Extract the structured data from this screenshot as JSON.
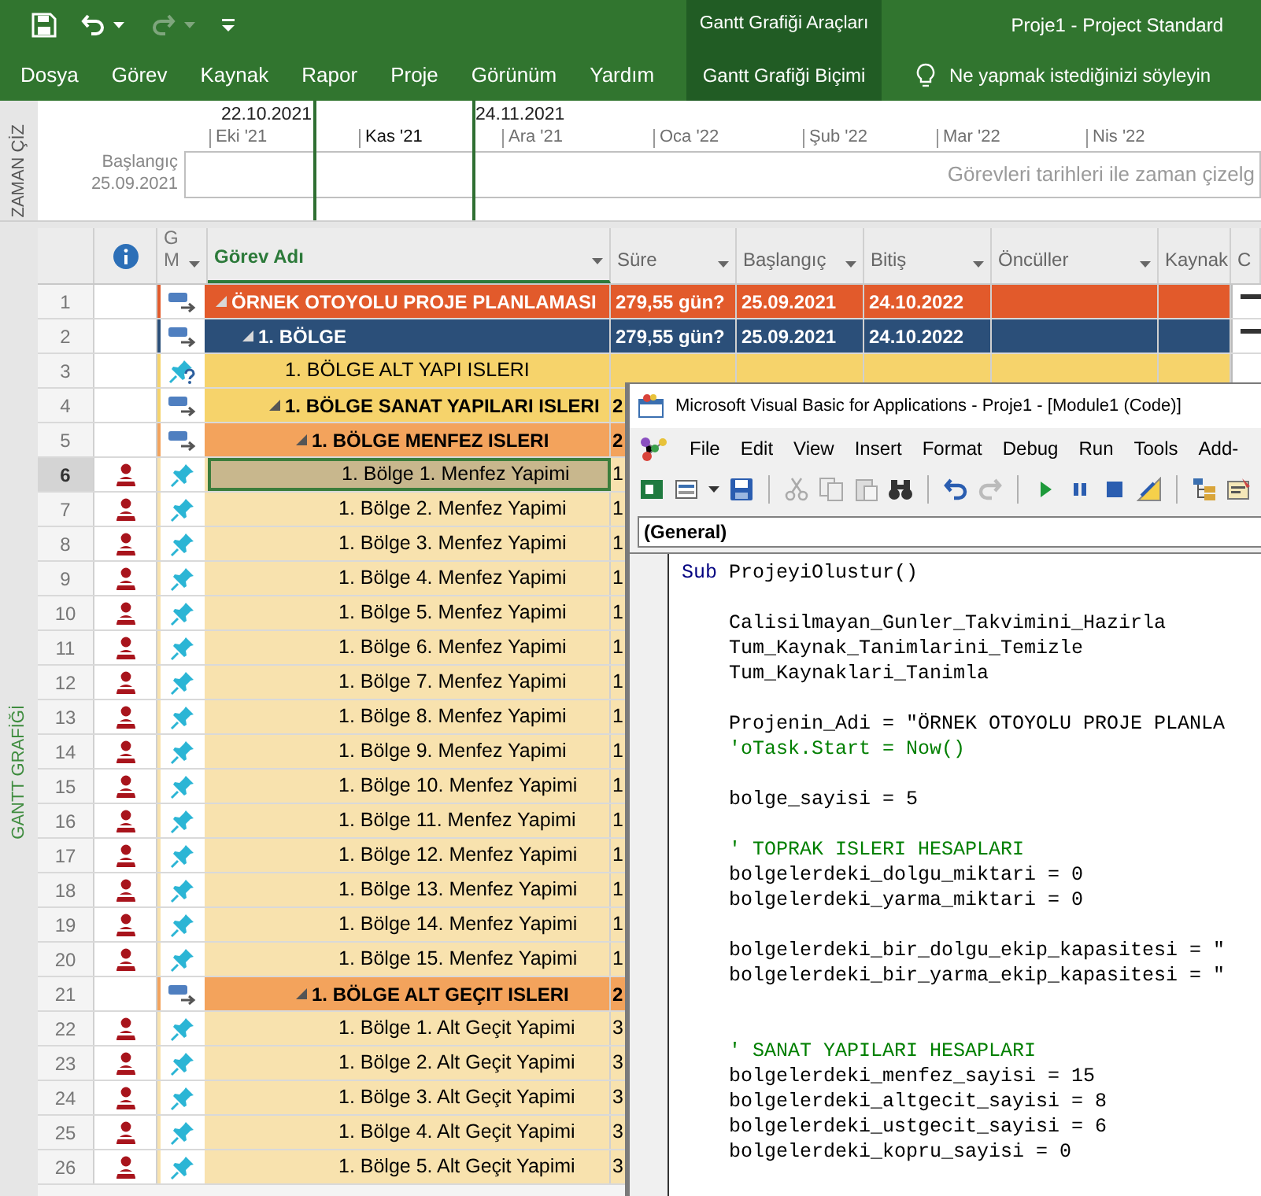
{
  "title_bar": {
    "context_group": "Gantt Grafiği Araçları",
    "title": "Proje1 - Project Standard"
  },
  "ribbon": {
    "tabs": [
      {
        "label": "Dosya",
        "selected": false
      },
      {
        "label": "Görev",
        "selected": false
      },
      {
        "label": "Kaynak",
        "selected": false
      },
      {
        "label": "Rapor",
        "selected": false
      },
      {
        "label": "Proje",
        "selected": false
      },
      {
        "label": "Görünüm",
        "selected": false
      },
      {
        "label": "Yardım",
        "selected": false
      }
    ],
    "context_tab": "Gantt Grafiği Biçimi",
    "tell_me": "Ne yapmak istediğinizi söyleyin"
  },
  "timeline": {
    "side_label": "ZAMAN ÇİZ",
    "range_start": "22.10.2021",
    "range_end": "24.11.2021",
    "months": [
      {
        "label": "Eki '21",
        "in_range": false
      },
      {
        "label": "Kas '21",
        "in_range": true
      },
      {
        "label": "Ara '21",
        "in_range": false
      },
      {
        "label": "Oca '22",
        "in_range": false
      },
      {
        "label": "Şub '22",
        "in_range": false
      },
      {
        "label": "Mar '22",
        "in_range": false
      },
      {
        "label": "Nis '22",
        "in_range": false
      }
    ],
    "start_label": "Başlangıç",
    "start_date": "25.09.2021",
    "hint": "Görevleri tarihleri ile zaman çizelg"
  },
  "gantt": {
    "side_label": "GANTT GRAFİĞİ",
    "columns": [
      {
        "kind": "info"
      },
      {
        "kind": "mode",
        "label": "G M",
        "selected": false,
        "filter": true
      },
      {
        "kind": "name",
        "label": "Görev Adı",
        "selected": true,
        "filter": true
      },
      {
        "kind": "duration",
        "label": "Süre",
        "selected": false,
        "filter": true
      },
      {
        "kind": "start",
        "label": "Başlangıç",
        "selected": false,
        "filter": true
      },
      {
        "kind": "finish",
        "label": "Bitiş",
        "selected": false,
        "filter": true
      },
      {
        "kind": "predecessors",
        "label": "Öncüller",
        "selected": false,
        "filter": true
      },
      {
        "kind": "resources",
        "label": "Kaynak",
        "selected": false,
        "filter": false
      },
      {
        "kind": "chart",
        "label": "C",
        "selected": false,
        "filter": false
      }
    ],
    "rows": [
      {
        "id": "1",
        "assigned": false,
        "kind": "auto",
        "name": "ÖRNEK OTOYOLU PROJE PLANLAMASI",
        "duration": "279,55 gün?",
        "start": "25.09.2021",
        "finish": "24.10.2022",
        "color": "#e25a2b",
        "selected": false,
        "expanded": true,
        "children": [
          {
            "id": "2",
            "assigned": false,
            "kind": "auto",
            "name": "1. BÖLGE",
            "duration": "279,55 gün?",
            "start": "25.09.2021",
            "finish": "24.10.2022",
            "color": "#2b4f79",
            "selected": false,
            "expanded": true,
            "children": [
              {
                "id": "3",
                "assigned": false,
                "kind": "manual_unscheduled",
                "name": "1. BÖLGE ALT YAPI ISLERI",
                "color": "#f6d36b",
                "selected": false
              },
              {
                "id": "4",
                "assigned": false,
                "kind": "auto",
                "name": "1. BÖLGE SANAT YAPILARI ISLERI",
                "duration": "2",
                "color": "#f6d36b",
                "selected": false,
                "expanded": true,
                "children": [
                  {
                    "id": "5",
                    "assigned": false,
                    "kind": "auto",
                    "name": "1. BÖLGE MENFEZ ISLERI",
                    "duration": "2",
                    "color": "#f3a35c",
                    "selected": false,
                    "expanded": true,
                    "children": [
                      {
                        "id": "6",
                        "assigned": true,
                        "kind": "manual",
                        "name": "1. Bölge 1. Menfez Yapimi",
                        "duration": "1",
                        "color": "#f8e2ae",
                        "selected": true
                      },
                      {
                        "id": "7",
                        "assigned": true,
                        "kind": "manual",
                        "name": "1. Bölge 2. Menfez Yapimi",
                        "duration": "1",
                        "color": "#f8e2ae",
                        "selected": false
                      },
                      {
                        "id": "8",
                        "assigned": true,
                        "kind": "manual",
                        "name": "1. Bölge 3. Menfez Yapimi",
                        "duration": "1",
                        "color": "#f8e2ae",
                        "selected": false
                      },
                      {
                        "id": "9",
                        "assigned": true,
                        "kind": "manual",
                        "name": "1. Bölge 4. Menfez Yapimi",
                        "duration": "1",
                        "color": "#f8e2ae",
                        "selected": false
                      },
                      {
                        "id": "10",
                        "assigned": true,
                        "kind": "manual",
                        "name": "1. Bölge 5. Menfez Yapimi",
                        "duration": "1",
                        "color": "#f8e2ae",
                        "selected": false
                      },
                      {
                        "id": "11",
                        "assigned": true,
                        "kind": "manual",
                        "name": "1. Bölge 6. Menfez Yapimi",
                        "duration": "1",
                        "color": "#f8e2ae",
                        "selected": false
                      },
                      {
                        "id": "12",
                        "assigned": true,
                        "kind": "manual",
                        "name": "1. Bölge 7. Menfez Yapimi",
                        "duration": "1",
                        "color": "#f8e2ae",
                        "selected": false
                      },
                      {
                        "id": "13",
                        "assigned": true,
                        "kind": "manual",
                        "name": "1. Bölge 8. Menfez Yapimi",
                        "duration": "1",
                        "color": "#f8e2ae",
                        "selected": false
                      },
                      {
                        "id": "14",
                        "assigned": true,
                        "kind": "manual",
                        "name": "1. Bölge 9. Menfez Yapimi",
                        "duration": "1",
                        "color": "#f8e2ae",
                        "selected": false
                      },
                      {
                        "id": "15",
                        "assigned": true,
                        "kind": "manual",
                        "name": "1. Bölge 10. Menfez Yapimi",
                        "duration": "1",
                        "color": "#f8e2ae",
                        "selected": false
                      },
                      {
                        "id": "16",
                        "assigned": true,
                        "kind": "manual",
                        "name": "1. Bölge 11. Menfez Yapimi",
                        "duration": "1",
                        "color": "#f8e2ae",
                        "selected": false
                      },
                      {
                        "id": "17",
                        "assigned": true,
                        "kind": "manual",
                        "name": "1. Bölge 12. Menfez Yapimi",
                        "duration": "1",
                        "color": "#f8e2ae",
                        "selected": false
                      },
                      {
                        "id": "18",
                        "assigned": true,
                        "kind": "manual",
                        "name": "1. Bölge 13. Menfez Yapimi",
                        "duration": "1",
                        "color": "#f8e2ae",
                        "selected": false
                      },
                      {
                        "id": "19",
                        "assigned": true,
                        "kind": "manual",
                        "name": "1. Bölge 14. Menfez Yapimi",
                        "duration": "1",
                        "color": "#f8e2ae",
                        "selected": false
                      },
                      {
                        "id": "20",
                        "assigned": true,
                        "kind": "manual",
                        "name": "1. Bölge 15. Menfez Yapimi",
                        "duration": "1",
                        "color": "#f8e2ae",
                        "selected": false
                      }
                    ]
                  },
                  {
                    "id": "21",
                    "assigned": false,
                    "kind": "auto",
                    "name": "1. BÖLGE ALT GEÇIT ISLERI",
                    "duration": "2",
                    "color": "#f3a35c",
                    "selected": false,
                    "expanded": true,
                    "children": [
                      {
                        "id": "22",
                        "assigned": true,
                        "kind": "manual",
                        "name": "1. Bölge 1. Alt Geçit Yapimi",
                        "duration": "3",
                        "color": "#f8e2ae",
                        "selected": false
                      },
                      {
                        "id": "23",
                        "assigned": true,
                        "kind": "manual",
                        "name": "1. Bölge 2. Alt Geçit Yapimi",
                        "duration": "3",
                        "color": "#f8e2ae",
                        "selected": false
                      },
                      {
                        "id": "24",
                        "assigned": true,
                        "kind": "manual",
                        "name": "1. Bölge 3. Alt Geçit Yapimi",
                        "duration": "3",
                        "color": "#f8e2ae",
                        "selected": false
                      },
                      {
                        "id": "25",
                        "assigned": true,
                        "kind": "manual",
                        "name": "1. Bölge 4. Alt Geçit Yapimi",
                        "duration": "3",
                        "color": "#f8e2ae",
                        "selected": false
                      },
                      {
                        "id": "26",
                        "assigned": true,
                        "kind": "manual",
                        "name": "1. Bölge 5. Alt Geçit Yapimi",
                        "duration": "3",
                        "color": "#f8e2ae",
                        "selected": false
                      }
                    ]
                  }
                ]
              }
            ]
          }
        ]
      }
    ]
  },
  "code_window": {
    "title": "Microsoft Visual Basic for Applications - Proje1 - [Module1 (Code)]",
    "menu": [
      "File",
      "Edit",
      "View",
      "Insert",
      "Format",
      "Debug",
      "Run",
      "Tools",
      "Add-"
    ],
    "object_box": "(General)",
    "blocks": [
      {
        "kind": "none",
        "lines": [
          {
            "kind": "declaration",
            "segments": [
              {
                "kind": "keyword",
                "text": "Sub"
              },
              {
                "kind": "plain",
                "text": "ProjeyiOlustur()"
              }
            ]
          }
        ]
      },
      {
        "kind": "single",
        "lines": [
          {
            "kind": "statement",
            "segments": [
              {
                "kind": "plain",
                "text": "Calisilmayan_Gunler_Takvimini_Hazirla"
              }
            ]
          },
          {
            "kind": "statement",
            "segments": [
              {
                "kind": "plain",
                "text": "Tum_Kaynak_Tanimlarini_Temizle"
              }
            ]
          },
          {
            "kind": "statement",
            "segments": [
              {
                "kind": "plain",
                "text": "Tum_Kaynaklari_Tanimla"
              }
            ]
          }
        ]
      },
      {
        "kind": "single",
        "lines": [
          {
            "kind": "statement",
            "segments": [
              {
                "kind": "plain",
                "text": "Projenin_Adi = \"ÖRNEK OTOYOLU PROJE PLANLA"
              }
            ]
          },
          {
            "kind": "statement",
            "segments": [
              {
                "kind": "comment",
                "text": "'oTask.Start = Now()"
              }
            ]
          }
        ]
      },
      {
        "kind": "single",
        "lines": [
          {
            "kind": "statement",
            "segments": [
              {
                "kind": "plain",
                "text": "bolge_sayisi = 5"
              }
            ]
          }
        ]
      },
      {
        "kind": "single",
        "lines": [
          {
            "kind": "statement",
            "segments": [
              {
                "kind": "comment",
                "text": "' TOPRAK ISLERI HESAPLARI"
              }
            ]
          },
          {
            "kind": "statement",
            "segments": [
              {
                "kind": "plain",
                "text": "bolgelerdeki_dolgu_miktari = 0"
              }
            ]
          },
          {
            "kind": "statement",
            "segments": [
              {
                "kind": "plain",
                "text": "bolgelerdeki_yarma_miktari = 0"
              }
            ]
          }
        ]
      },
      {
        "kind": "single",
        "lines": [
          {
            "kind": "statement",
            "segments": [
              {
                "kind": "plain",
                "text": "bolgelerdeki_bir_dolgu_ekip_kapasitesi = \""
              }
            ]
          },
          {
            "kind": "statement",
            "segments": [
              {
                "kind": "plain",
                "text": "bolgelerdeki_bir_yarma_ekip_kapasitesi = \""
              }
            ]
          }
        ]
      },
      {
        "kind": "double",
        "lines": [
          {
            "kind": "statement",
            "segments": [
              {
                "kind": "comment",
                "text": "' SANAT YAPILARI HESAPLARI"
              }
            ]
          },
          {
            "kind": "statement",
            "segments": [
              {
                "kind": "plain",
                "text": "bolgelerdeki_menfez_sayisi = 15"
              }
            ]
          },
          {
            "kind": "statement",
            "segments": [
              {
                "kind": "plain",
                "text": "bolgelerdeki_altgecit_sayisi = 8"
              }
            ]
          },
          {
            "kind": "statement",
            "segments": [
              {
                "kind": "plain",
                "text": "bolgelerdeki_ustgecit_sayisi = 6"
              }
            ]
          },
          {
            "kind": "statement",
            "segments": [
              {
                "kind": "plain",
                "text": "bolgelerdeki_kopru_sayisi = 0"
              }
            ]
          }
        ]
      }
    ]
  }
}
